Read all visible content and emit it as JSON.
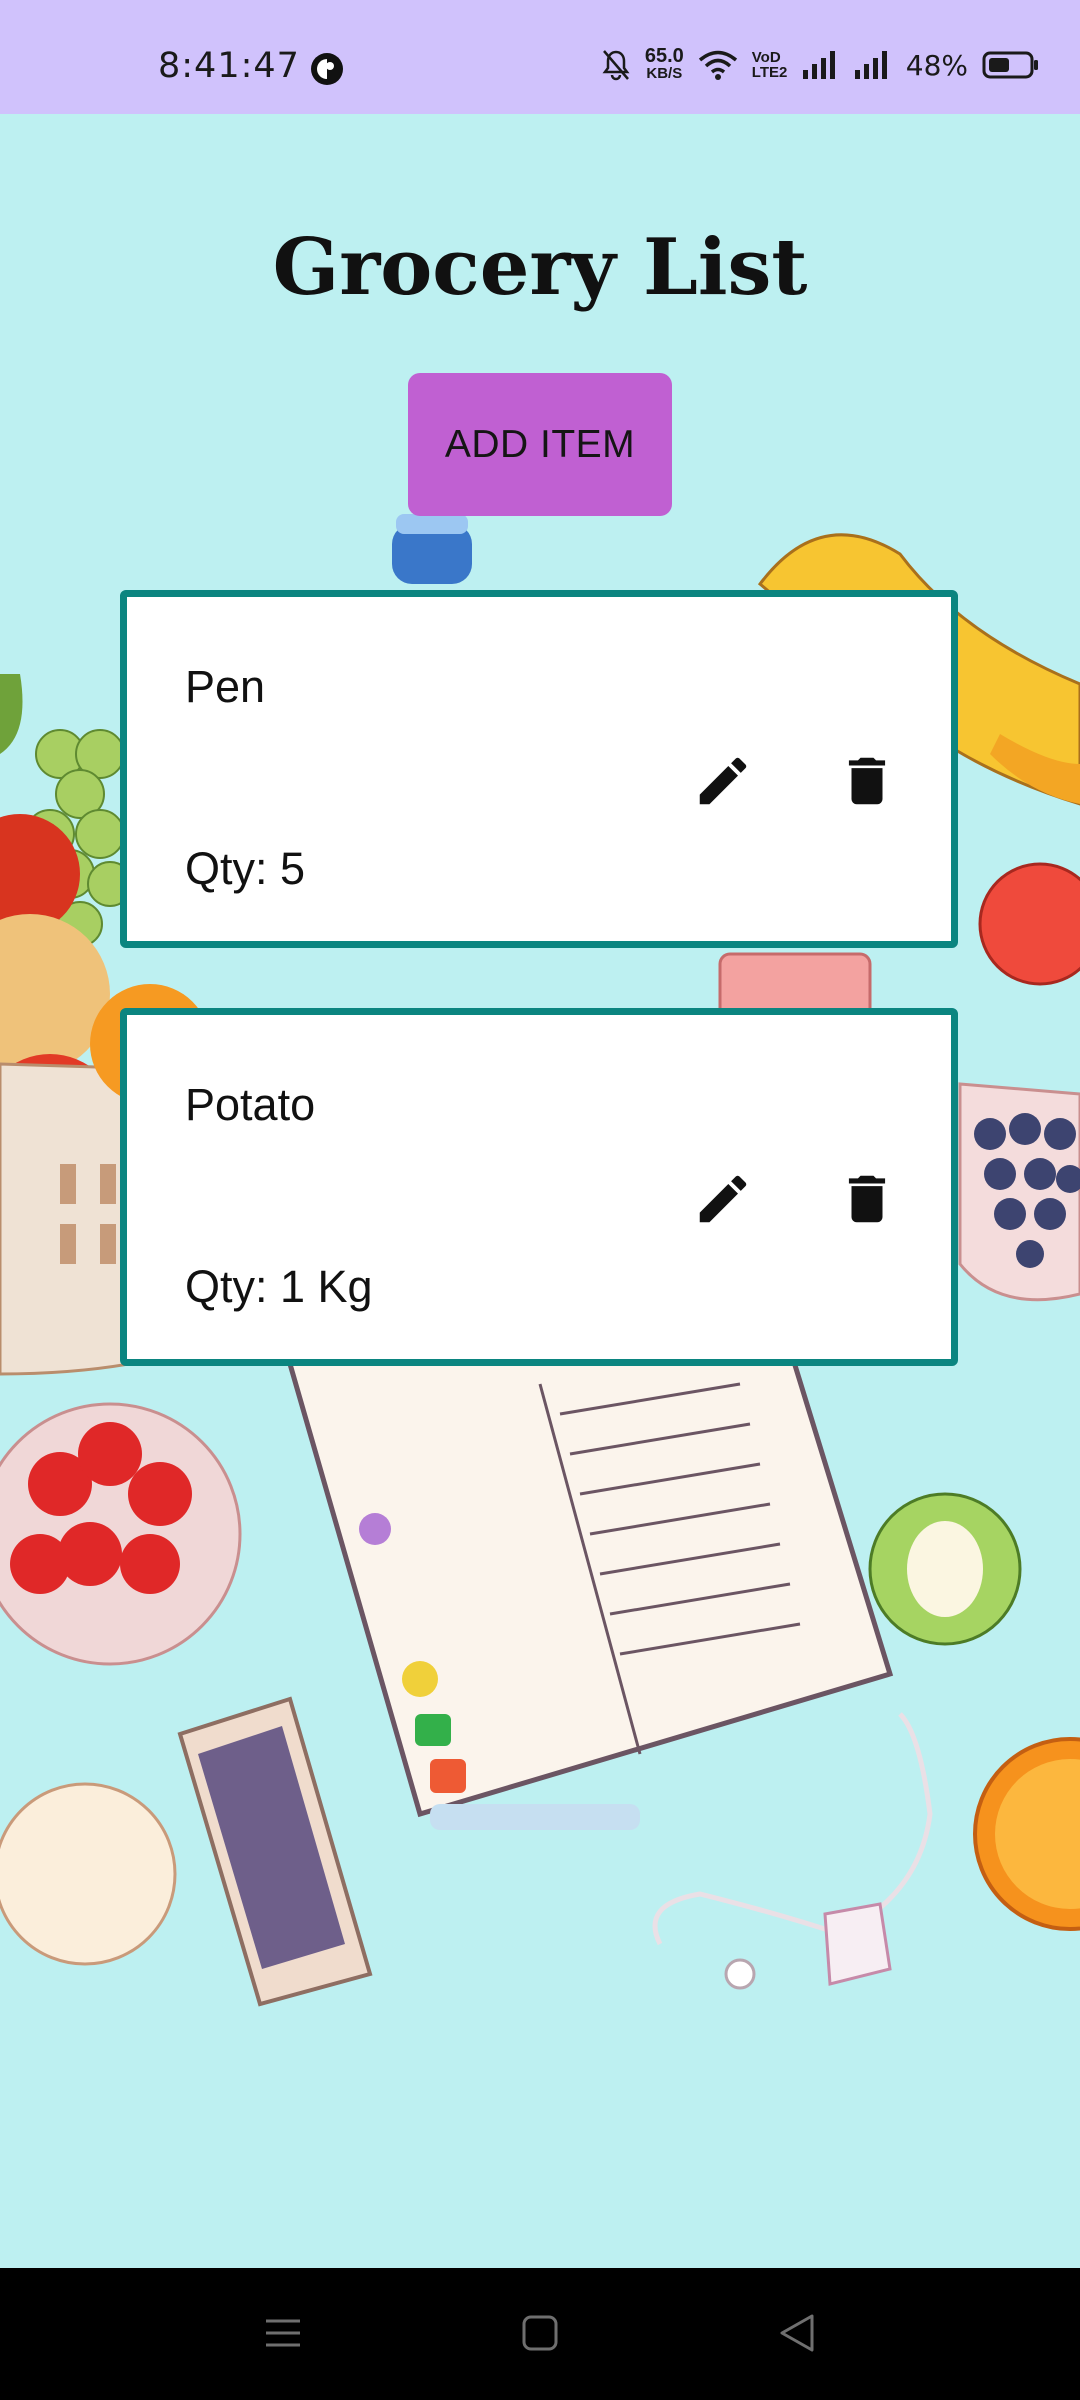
{
  "status_bar": {
    "time": "8:41:47",
    "net_speed_value": "65.0",
    "net_speed_unit": "KB/S",
    "volte": "VoD LTE2",
    "battery": "48%"
  },
  "page": {
    "title": "Grocery List",
    "add_button_label": "ADD ITEM"
  },
  "items": [
    {
      "name": "Pen",
      "qty": "Qty: 5"
    },
    {
      "name": "Potato",
      "qty": "Qty: 1 Kg"
    }
  ],
  "colors": {
    "status_bar_bg": "#d0c2fc",
    "page_bg": "#bdf0f1",
    "add_button": "#c060d2",
    "card_border": "#0b8580"
  },
  "icons": {
    "edit": "pencil-icon",
    "delete": "trash-icon"
  }
}
